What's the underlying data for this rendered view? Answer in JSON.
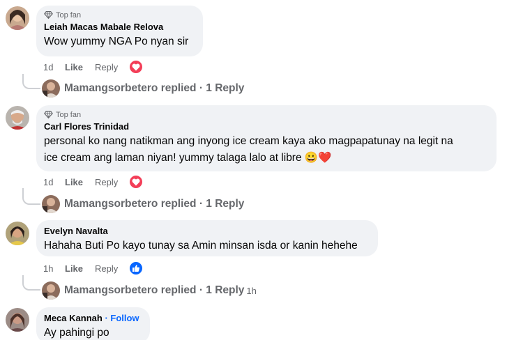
{
  "comments": [
    {
      "badge": "Top fan",
      "author": "Leiah Macas Mabale Relova",
      "lines": [
        "Wow yummy NGA Po nyan sir"
      ],
      "time": "1d",
      "like": "Like",
      "reply": "Reply",
      "reaction": "love-icon",
      "replies": {
        "name": "Mamangsorbetero",
        "text": "replied · 1 Reply",
        "age": ""
      }
    },
    {
      "badge": "Top fan",
      "author": "Carl Flores Trinidad",
      "lines": [
        "personal ko nang natikman ang inyong ice cream kaya ako magpapatunay na legit na",
        "ice cream ang laman niyan! yummy talaga lalo at libre 😀❤️"
      ],
      "time": "1d",
      "like": "Like",
      "reply": "Reply",
      "reaction": "love-icon",
      "replies": {
        "name": "Mamangsorbetero",
        "text": "replied · 1 Reply",
        "age": ""
      }
    },
    {
      "author": "Evelyn Navalta",
      "lines": [
        "Hahaha Buti Po kayo tunay sa Amin minsan isda or kanin hehehe"
      ],
      "time": "1h",
      "like": "Like",
      "reply": "Reply",
      "reaction": "thumbs-up-icon",
      "replies": {
        "name": "Mamangsorbetero",
        "text": "replied · 1 Reply",
        "age": "1h"
      }
    },
    {
      "author": "Meca Kannah",
      "follow": "· Follow",
      "lines": [
        "Ay pahingi po"
      ]
    }
  ],
  "colors": {
    "bubble": "#f0f2f5",
    "love": "#f33e58",
    "like": "#0866ff",
    "follow": "#0866ff"
  }
}
